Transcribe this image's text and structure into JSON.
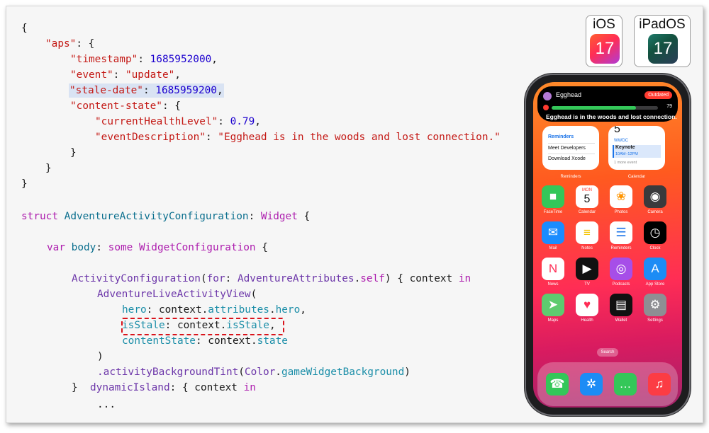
{
  "code": {
    "json_lines": [
      "{",
      "\"aps\": {",
      "\"timestamp\": 1685952000,",
      "\"event\": \"update\",",
      "\"stale-date\": 1685959200,",
      "\"content-state\": {",
      "\"currentHealthLevel\": 0.79,",
      "\"eventDescription\": \"Egghead is in the woods and lost connection.\"",
      "}",
      "}",
      "}"
    ],
    "json": {
      "open_brace": "{",
      "aps_key": "\"aps\"",
      "timestamp_key": "\"timestamp\"",
      "timestamp_value": "1685952000",
      "event_key": "\"event\"",
      "event_value": "\"update\"",
      "stale_key": "\"stale-date\"",
      "stale_value": "1685959200",
      "content_state_key": "\"content-state\"",
      "health_key": "\"currentHealthLevel\"",
      "health_value": "0.79",
      "desc_key": "\"eventDescription\"",
      "desc_value": "\"Egghead is in the woods and lost connection.\"",
      "close_brace": "}"
    },
    "swift": {
      "kw_struct": "struct",
      "struct_name": "AdventureActivityConfiguration",
      "widget_type": "Widget",
      "kw_var": "var",
      "body_name": "body",
      "kw_some": "some",
      "config_type": "WidgetConfiguration",
      "activity_config": "ActivityConfiguration",
      "for_label": "for",
      "attributes_type": "AdventureAttributes",
      "kw_self": "self",
      "context_name": "context",
      "kw_in": "in",
      "live_view": "AdventureLiveActivityView",
      "hero_label": "hero",
      "context_dot": "context.",
      "attributes_prop": "attributes",
      "hero_prop": "hero",
      "is_stale_label": "isStale",
      "is_stale_prop": "isStale",
      "content_state_label": "contentState",
      "state_prop": "state",
      "close_paren": ")",
      "bg_tint_fn": ".activityBackgroundTint",
      "color_type": "Color",
      "game_bg": "gameWidgetBackground",
      "close_brace": "}",
      "dynamic_island": "dynamicIsland",
      "ellipsis": "..."
    }
  },
  "badges": {
    "ios_label": "iOS",
    "ios_version": "17",
    "ipados_label": "iPadOS",
    "ipados_version": "17"
  },
  "phone": {
    "live_activity": {
      "title": "Egghead",
      "status": "Outdated",
      "health_fraction": 0.79,
      "health_value": "79",
      "description": "Egghead is in the woods and lost connection."
    },
    "widgets": {
      "reminders": {
        "heading": "Reminders",
        "items": [
          "Meet Developers",
          "Download Xcode"
        ],
        "label": "Reminders"
      },
      "calendar": {
        "day": "5",
        "event_group": "WWDC",
        "event_title": "Keynote",
        "event_time": "10AM–12PM",
        "more": "1 more event",
        "label": "Calendar"
      }
    },
    "apps": [
      {
        "name": "FaceTime",
        "icon": "facetime-icon",
        "color": "#34c759"
      },
      {
        "name": "Calendar",
        "icon": "calendar-icon",
        "color": "#ffffff"
      },
      {
        "name": "Photos",
        "icon": "photos-icon",
        "color": "#ffffff"
      },
      {
        "name": "Camera",
        "icon": "camera-icon",
        "color": "#3a3a3c"
      },
      {
        "name": "Mail",
        "icon": "mail-icon",
        "color": "#1a8cff"
      },
      {
        "name": "Notes",
        "icon": "notes-icon",
        "color": "#ffffff"
      },
      {
        "name": "Reminders",
        "icon": "reminders-icon",
        "color": "#ffffff"
      },
      {
        "name": "Clock",
        "icon": "clock-icon",
        "color": "#000000"
      },
      {
        "name": "News",
        "icon": "news-icon",
        "color": "#ffffff"
      },
      {
        "name": "TV",
        "icon": "tv-icon",
        "color": "#111111"
      },
      {
        "name": "Podcasts",
        "icon": "podcasts-icon",
        "color": "#a64ee8"
      },
      {
        "name": "App Store",
        "icon": "app-store-icon",
        "color": "#1c8cf5"
      },
      {
        "name": "Maps",
        "icon": "maps-icon",
        "color": "#5ecb6f"
      },
      {
        "name": "Health",
        "icon": "health-icon",
        "color": "#ffffff"
      },
      {
        "name": "Wallet",
        "icon": "wallet-icon",
        "color": "#111111"
      },
      {
        "name": "Settings",
        "icon": "settings-icon",
        "color": "#8e8e93"
      }
    ],
    "calendar_icon_day": "5",
    "calendar_icon_weekday": "MON",
    "search_label": "Search",
    "dock": [
      {
        "icon": "phone-icon",
        "color": "#34c759"
      },
      {
        "icon": "safari-icon",
        "color": "#1c8cf5"
      },
      {
        "icon": "messages-icon",
        "color": "#34c759"
      },
      {
        "icon": "music-icon",
        "color": "#fc3c44"
      }
    ],
    "colors": {
      "wallpaper_top": "#ff8a2a",
      "wallpaper_bottom": "#a3246a",
      "stale_highlight": "#d9e3f3",
      "dashed_box": "#d9141c"
    }
  }
}
